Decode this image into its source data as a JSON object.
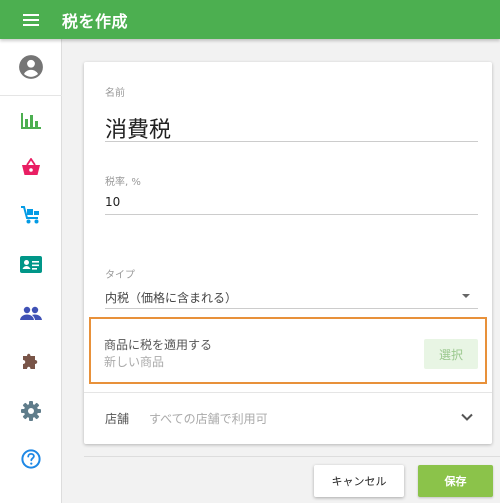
{
  "appbar": {
    "title": "税を作成",
    "menu_icon": "menu-icon"
  },
  "sidebar": {
    "items": [
      {
        "name": "account",
        "icon": "account-circle-icon",
        "color": "#757575"
      },
      {
        "name": "reports",
        "icon": "bar-chart-icon",
        "color": "#4caf50"
      },
      {
        "name": "sales",
        "icon": "basket-icon",
        "color": "#e91e63"
      },
      {
        "name": "items",
        "icon": "cart-icon",
        "color": "#039be5"
      },
      {
        "name": "employees",
        "icon": "badge-icon",
        "color": "#009688"
      },
      {
        "name": "customers",
        "icon": "people-icon",
        "color": "#3f51b5"
      },
      {
        "name": "integrations",
        "icon": "puzzle-icon",
        "color": "#795548"
      },
      {
        "name": "settings",
        "icon": "gear-icon",
        "color": "#607d8b"
      },
      {
        "name": "help",
        "icon": "help-icon",
        "color": "#1e88e5"
      }
    ]
  },
  "form": {
    "name_label": "名前",
    "name_value": "消費税",
    "rate_label": "税率, %",
    "rate_value": "10",
    "type_label": "タイプ",
    "type_value": "内税（価格に含まれる）",
    "apply_title": "商品に税を適用する",
    "apply_sub": "新しい商品",
    "select_label": "選択",
    "store_label": "店舗",
    "store_value": "すべての店舗で利用可"
  },
  "actions": {
    "cancel_label": "キャンセル",
    "save_label": "保存"
  },
  "colors": {
    "primary": "#4caf50",
    "accent": "#8bc34a",
    "highlight": "#e8913a"
  }
}
